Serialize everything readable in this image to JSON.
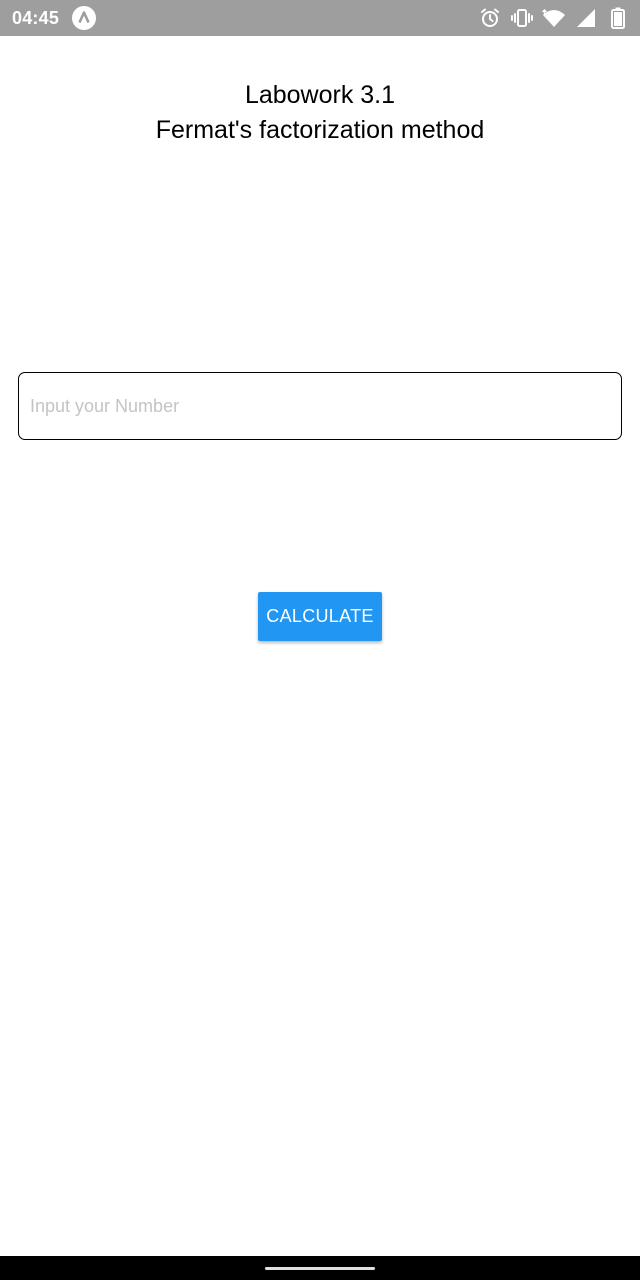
{
  "status_bar": {
    "time": "04:45",
    "icons": [
      "app-notification-icon",
      "alarm-icon",
      "vibrate-icon",
      "wifi-icon",
      "signal-icon",
      "battery-icon"
    ],
    "background": "#9e9e9e"
  },
  "header": {
    "title_line1": "Labowork 3.1",
    "title_line2": "Fermat's factorization method"
  },
  "form": {
    "number_input": {
      "placeholder": "Input your Number",
      "value": ""
    },
    "calculate_label": "CALCULATE"
  },
  "colors": {
    "accent": "#2196f3",
    "placeholder": "#c4c4c4"
  }
}
